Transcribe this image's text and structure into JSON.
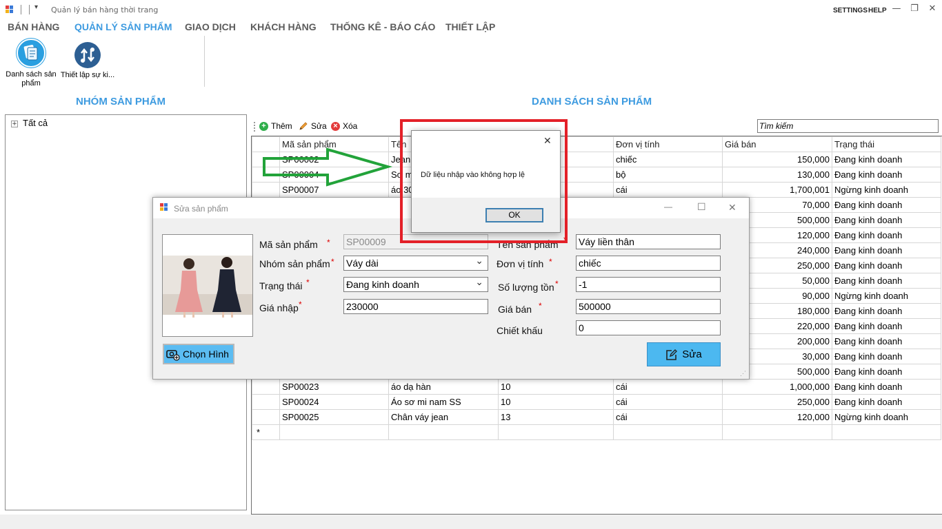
{
  "window": {
    "title": "Quản lý bán hàng thời trang",
    "settings": "SETTINGS",
    "help": "HELP",
    "minimize": "—",
    "restore": "❐",
    "close": "✕"
  },
  "menu": [
    "BÁN HÀNG",
    "QUẢN LÝ SẢN PHẨM",
    "GIAO DỊCH",
    "KHÁCH HÀNG",
    "THỐNG KÊ - BÁO CÁO",
    "THIẾT LẬP"
  ],
  "ribbon": {
    "product_list_line1": "Danh sách sản",
    "product_list_line2": "phẩm",
    "price_setup": "Thiết lập sự ki..."
  },
  "left_panel": {
    "title": "NHÓM SẢN PHẨM",
    "tree_root": "Tất cả",
    "expander": "+"
  },
  "main": {
    "title": "DANH SÁCH SẢN PHẨM",
    "toolbar": {
      "add": "Thêm",
      "edit": "Sửa",
      "delete": "Xóa"
    },
    "search_value": "Tìm kiếm"
  },
  "grid": {
    "columns": [
      "Mã sản phẩm",
      "Tên",
      "",
      "Đơn vị tính",
      "Giá bán",
      "Trạng thái"
    ],
    "rows": [
      [
        "SP00002",
        "Jean",
        "",
        "chiếc",
        "150,000",
        "Đang kinh doanh"
      ],
      [
        "SP00004",
        "Sơ m",
        "",
        "bộ",
        "130,000",
        "Đang kinh doanh"
      ],
      [
        "SP00007",
        "áo 30",
        "",
        "cái",
        "1,700,001",
        "Ngừng kinh doanh"
      ],
      [
        "",
        "",
        "",
        "",
        "70,000",
        "Đang kinh doanh"
      ],
      [
        "",
        "",
        "",
        "",
        "500,000",
        "Đang kinh doanh"
      ],
      [
        "",
        "",
        "",
        "",
        "120,000",
        "Đang kinh doanh"
      ],
      [
        "",
        "",
        "",
        "",
        "240,000",
        "Đang kinh doanh"
      ],
      [
        "",
        "",
        "",
        "",
        "250,000",
        "Đang kinh doanh"
      ],
      [
        "",
        "",
        "",
        "",
        "50,000",
        "Đang kinh doanh"
      ],
      [
        "",
        "",
        "",
        "",
        "90,000",
        "Ngừng kinh doanh"
      ],
      [
        "",
        "",
        "",
        "",
        "180,000",
        "Đang kinh doanh"
      ],
      [
        "",
        "",
        "",
        "",
        "220,000",
        "Đang kinh doanh"
      ],
      [
        "",
        "",
        "",
        "",
        "200,000",
        "Đang kinh doanh"
      ],
      [
        "",
        "",
        "",
        "",
        "30,000",
        "Đang kinh doanh"
      ],
      [
        "",
        "",
        "",
        "",
        "500,000",
        "Đang kinh doanh"
      ],
      [
        "SP00023",
        "áo dạ hàn",
        "10",
        "cái",
        "1,000,000",
        "Đang kinh doanh"
      ],
      [
        "SP00024",
        "Áo sơ mi nam SS",
        "10",
        "cái",
        "250,000",
        "Đang kinh doanh"
      ],
      [
        "SP00025",
        "Chân váy jean",
        "13",
        "cái",
        "120,000",
        "Ngừng kinh doanh"
      ]
    ],
    "new_row_marker": "*"
  },
  "edit_dialog": {
    "title": "Sửa sản phẩm",
    "labels": {
      "code": "Mã sản phẩm",
      "group": "Nhóm sản phẩm",
      "status": "Trạng thái",
      "cost": "Giá nhập",
      "name": "Tên sản phẩm",
      "unit": "Đơn vị tính",
      "stock": "Số lượng tồn",
      "price": "Giá bán",
      "discount": "Chiết khấu"
    },
    "required_mark": "*",
    "values": {
      "code": "SP00009",
      "group": "Váy dài",
      "status": "Đang kinh doanh",
      "cost": "230000",
      "name": "Váy liền thân",
      "unit": "chiếc",
      "stock": "-1",
      "price": "500000",
      "discount": "0"
    },
    "choose_image": "Chọn Hình",
    "save": "Sửa",
    "maximize": "☐",
    "close": "✕",
    "minimize": "—"
  },
  "message_box": {
    "text": "Dữ liệu nhập vào không hợp lệ",
    "ok": "OK",
    "close": "✕"
  },
  "colors": {
    "accent": "#3e9be0",
    "highlight": "#e32028",
    "arrow": "#22a33a",
    "button": "#4cb8f0"
  }
}
